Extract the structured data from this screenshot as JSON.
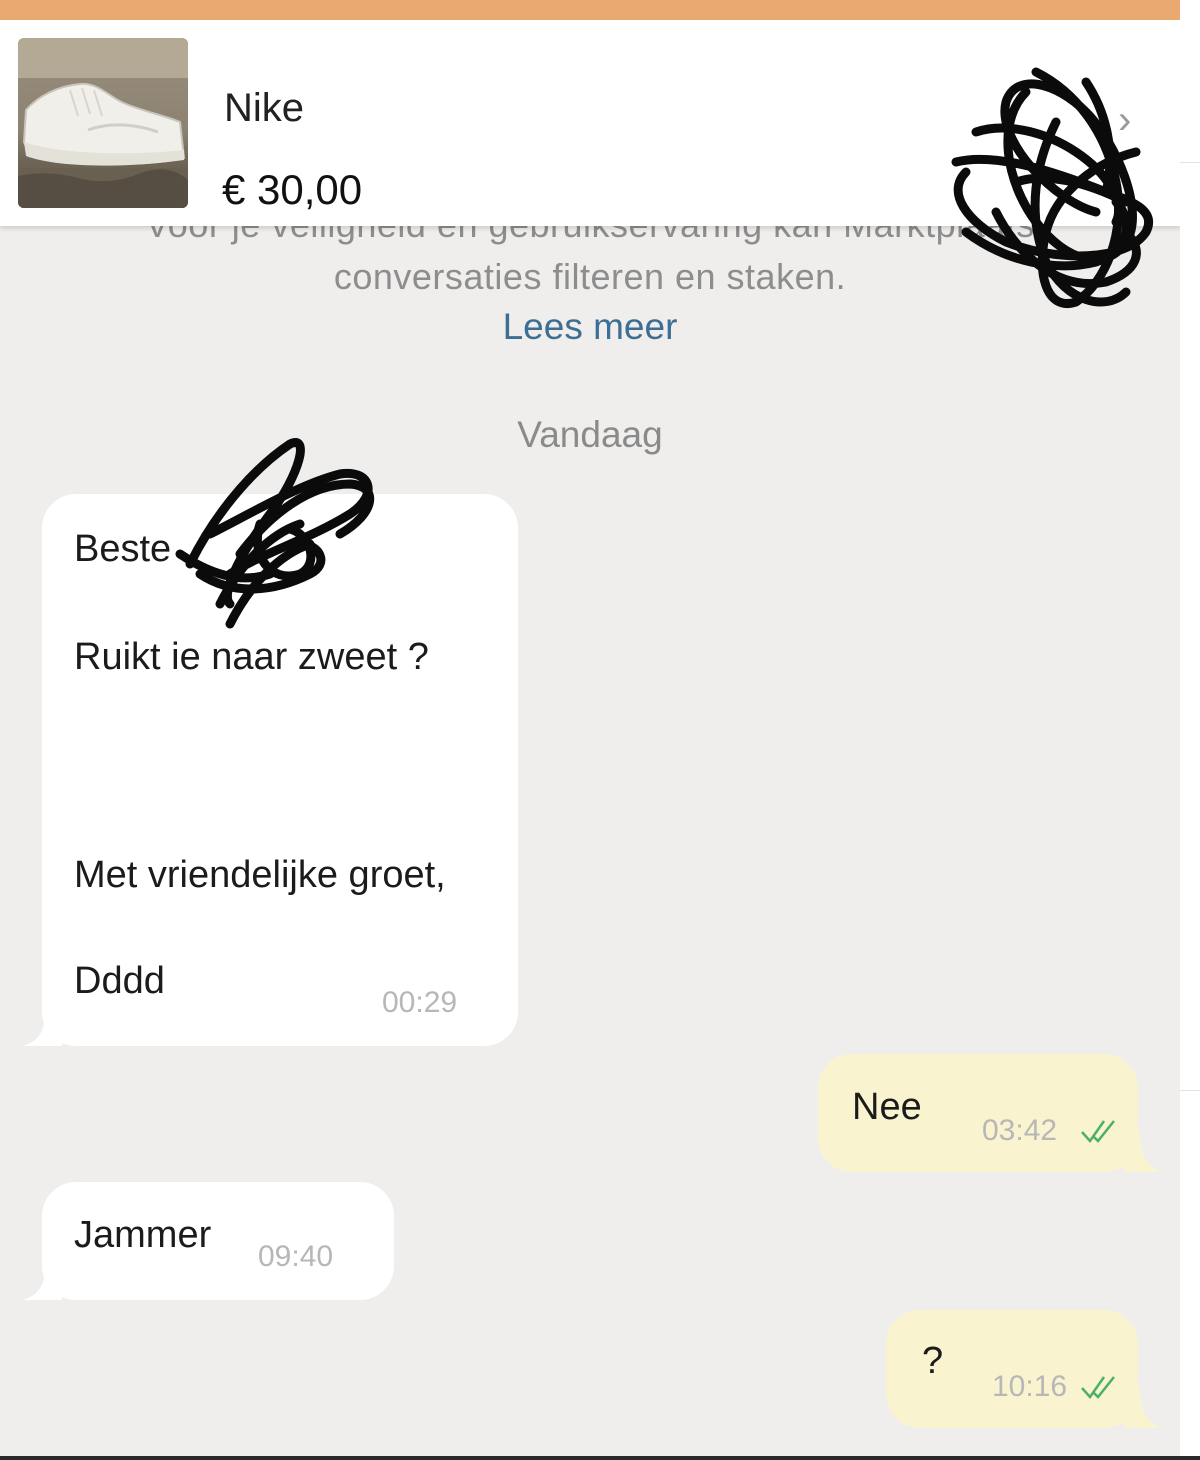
{
  "listing": {
    "title": "Nike",
    "price": "€ 30,00",
    "image": "sneaker-photo",
    "chevron": "›"
  },
  "notice": {
    "line1": "Voor je veiligheid en gebruikservaring kan Marktplaats",
    "line2": "conversaties filteren en staken.",
    "link": "Lees meer"
  },
  "date_separator": "Vandaag",
  "messages": [
    {
      "direction": "incoming",
      "lines": [
        "Beste",
        "Ruikt ie naar zweet ?",
        "Met vriendelijke groet,",
        "Dddd"
      ],
      "time": "00:29"
    },
    {
      "direction": "outgoing",
      "text": "Nee",
      "time": "03:42",
      "status": "read-check-icon"
    },
    {
      "direction": "incoming",
      "text": "Jammer",
      "time": "09:40"
    },
    {
      "direction": "outgoing",
      "text": "?",
      "time": "10:16",
      "status": "read-check-icon"
    }
  ],
  "colors": {
    "topbar": "#e9a970",
    "background": "#efeeec",
    "incoming_bubble": "#ffffff",
    "outgoing_bubble": "#faf3cf",
    "link": "#3d6f94",
    "read_check": "#4caf6a"
  }
}
